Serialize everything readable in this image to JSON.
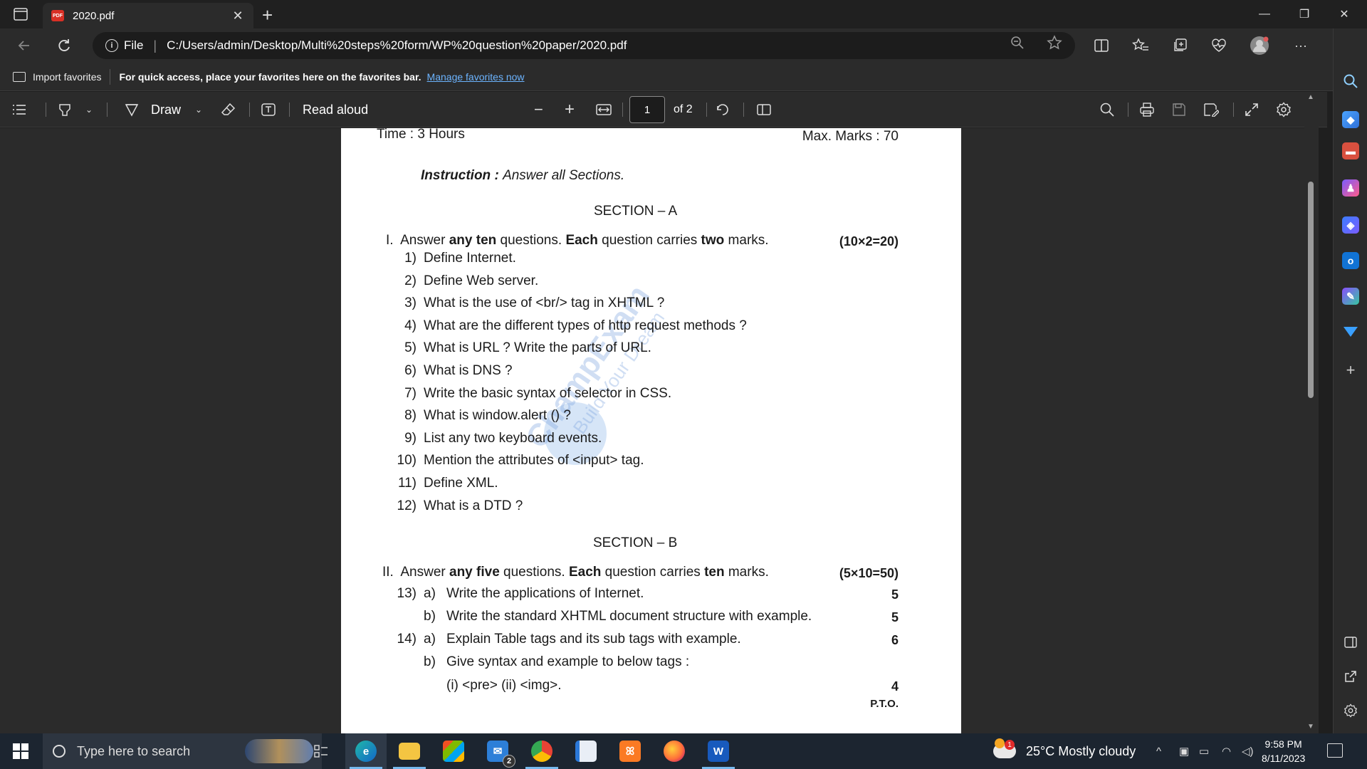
{
  "browser": {
    "tab_title": "2020.pdf",
    "tab_badge": "PDF",
    "scheme_label": "File",
    "url": "C:/Users/admin/Desktop/Multi%20steps%20form/WP%20question%20paper/2020.pdf"
  },
  "favorites_bar": {
    "import_label": "Import favorites",
    "message": "For quick access, place your favorites here on the favorites bar.",
    "manage_link": "Manage favorites now"
  },
  "pdf_toolbar": {
    "draw_label": "Draw",
    "read_aloud_label": "Read aloud",
    "current_page": "1",
    "page_total": "of 2"
  },
  "document": {
    "time": "Time : 3 Hours",
    "max_marks": "Max. Marks : 70",
    "instruction_label": "Instruction :",
    "instruction_text": "Answer all Sections.",
    "section_a": {
      "heading": "SECTION – A",
      "numeral": "I.",
      "lead": "Answer",
      "bold1": "any ten",
      "mid1": "questions.",
      "bold2": "Each",
      "mid2": "question carries",
      "bold3": "two",
      "tail": "marks.",
      "marks": "(10×2=20)",
      "questions": [
        {
          "num": "1)",
          "text": "Define Internet."
        },
        {
          "num": "2)",
          "text": "Define Web server."
        },
        {
          "num": "3)",
          "text": "What is the use of <br/> tag in XHTML ?"
        },
        {
          "num": "4)",
          "text": "What are the different types of http request methods ?"
        },
        {
          "num": "5)",
          "text": "What is URL ? Write the parts of URL."
        },
        {
          "num": "6)",
          "text": "What is DNS ?"
        },
        {
          "num": "7)",
          "text": "Write the basic syntax of selector in CSS."
        },
        {
          "num": "8)",
          "text": "What is window.alert () ?"
        },
        {
          "num": "9)",
          "text": "List any two keyboard events."
        },
        {
          "num": "10)",
          "text": "Mention the attributes of <input> tag."
        },
        {
          "num": "11)",
          "text": "Define XML."
        },
        {
          "num": "12)",
          "text": "What is a DTD ?"
        }
      ]
    },
    "section_b": {
      "heading": "SECTION – B",
      "numeral": "II.",
      "lead": "Answer",
      "bold1": "any five",
      "mid1": "questions.",
      "bold2": "Each",
      "mid2": "question carries",
      "bold3": "ten",
      "tail": "marks.",
      "marks": "(5×10=50)",
      "items": [
        {
          "num": "13)",
          "part": "a)",
          "text": "Write the applications of Internet.",
          "marks": "5"
        },
        {
          "num": "",
          "part": "b)",
          "text": "Write the standard XHTML document structure with example.",
          "marks": "5"
        },
        {
          "num": "14)",
          "part": "a)",
          "text": "Explain Table tags and its sub tags with example.",
          "marks": "6"
        },
        {
          "num": "",
          "part": "b)",
          "text": "Give syntax and example to below tags :",
          "marks": ""
        },
        {
          "num": "",
          "part": "",
          "text": "(i) <pre> (ii) <img>.",
          "marks": "4"
        }
      ],
      "pto": "P.T.O."
    },
    "watermark_title": "ChampExam",
    "watermark_tagline": "Build Your Dream"
  },
  "taskbar": {
    "search_placeholder": "Type here to search",
    "mail_badge": "2",
    "weather_alert": "1",
    "weather": "25°C  Mostly cloudy",
    "time": "9:58 PM",
    "date": "8/11/2023"
  },
  "icons": {
    "edge_sidebar": [
      "search-icon",
      "shopping-tag-icon",
      "toolbox-icon",
      "games-icon",
      "copilot-icon",
      "outlook-icon",
      "designer-icon",
      "send-icon",
      "add-icon"
    ],
    "colors": {
      "pdf_red": "#d93025",
      "link_blue": "#6cb4ff",
      "taskbar": "#1c2530"
    }
  }
}
